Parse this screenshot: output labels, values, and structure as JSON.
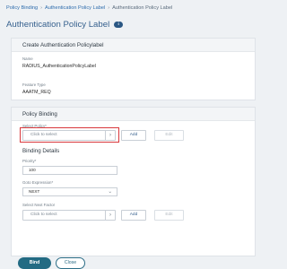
{
  "breadcrumb": {
    "items": [
      "Policy Binding",
      "Authentication Policy Label",
      "Authentication Policy Label"
    ]
  },
  "page": {
    "title": "Authentication Policy Label",
    "badge": "i"
  },
  "create_panel": {
    "header": "Create Authentication Policylabel",
    "name_label": "Name",
    "name_value": "RADIUS_AuthenticationPolicyLabel",
    "feature_label": "Feature Type",
    "feature_value": "AAATM_REQ"
  },
  "policy_binding": {
    "header": "Policy Binding",
    "select_policy_label": "Select Policy*",
    "select_policy_placeholder": "Click to select",
    "add_label": "Add",
    "edit_label": "Edit"
  },
  "binding_details": {
    "title": "Binding Details",
    "priority_label": "Priority*",
    "priority_value": "100",
    "goto_label": "Goto Expression*",
    "goto_value": "NEXT",
    "next_factor_label": "Select Next Factor",
    "next_factor_placeholder": "Click to select",
    "add_label": "Add",
    "edit_label": "Edit"
  },
  "actions": {
    "bind_label": "Bind",
    "close_label": "Close"
  },
  "colors": {
    "accent": "#236b83",
    "title": "#37618e",
    "highlight": "#d9383c"
  }
}
